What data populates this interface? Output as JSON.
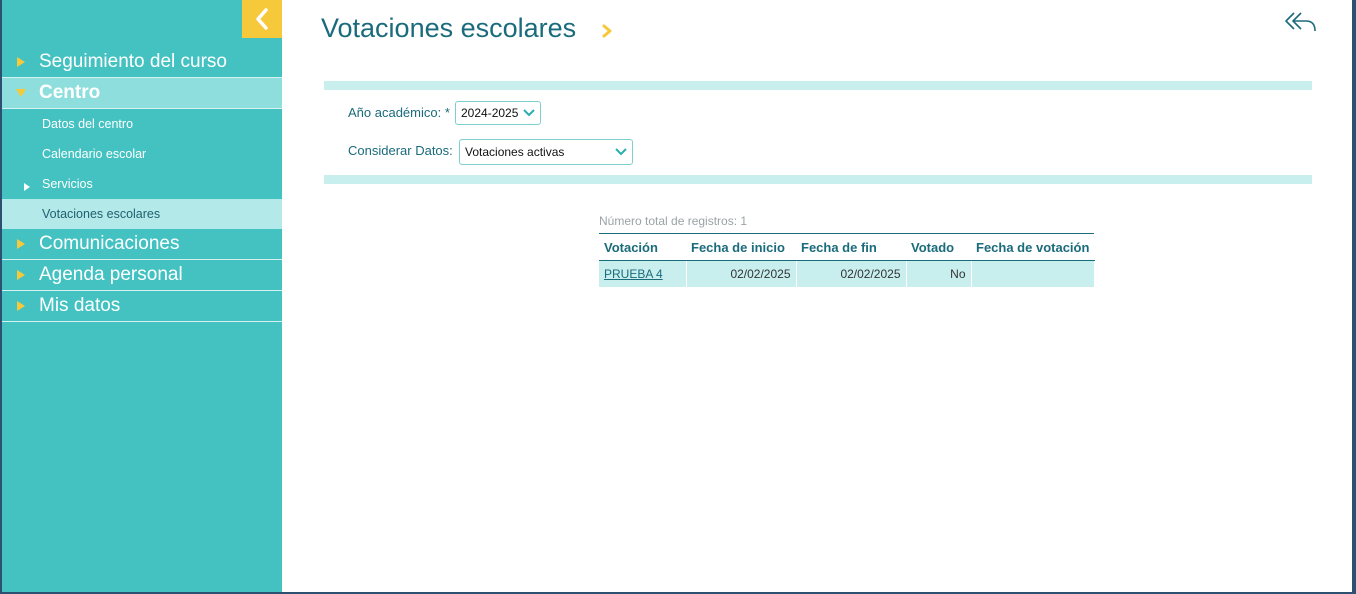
{
  "sidebar": {
    "collapse_icon": "chevron-left-icon",
    "items": [
      {
        "label": "Seguimiento del curso"
      },
      {
        "label": "Centro"
      },
      {
        "label": "Datos del centro"
      },
      {
        "label": "Calendario escolar"
      },
      {
        "label": "Servicios"
      },
      {
        "label": "Votaciones escolares"
      },
      {
        "label": "Comunicaciones"
      },
      {
        "label": "Agenda personal"
      },
      {
        "label": "Mis datos"
      }
    ]
  },
  "header": {
    "title": "Votaciones escolares",
    "back_icon": "reply-all-icon"
  },
  "filters": {
    "year_label": "Año académico: *",
    "year_value": "2024-2025",
    "data_label": "Considerar Datos:",
    "data_value": "Votaciones activas"
  },
  "table": {
    "records_text": "Número total de registros: 1",
    "columns": [
      "Votación",
      "Fecha de inicio",
      "Fecha de fin",
      "Votado",
      "Fecha de votación"
    ],
    "rows": [
      [
        "PRUEBA 4",
        "02/02/2025",
        "02/02/2025",
        "No",
        ""
      ]
    ]
  },
  "colors": {
    "sidebar": "#44c2c2",
    "accent": "#f6c93a",
    "title": "#1a6b7b",
    "band": "#c8eeee"
  }
}
